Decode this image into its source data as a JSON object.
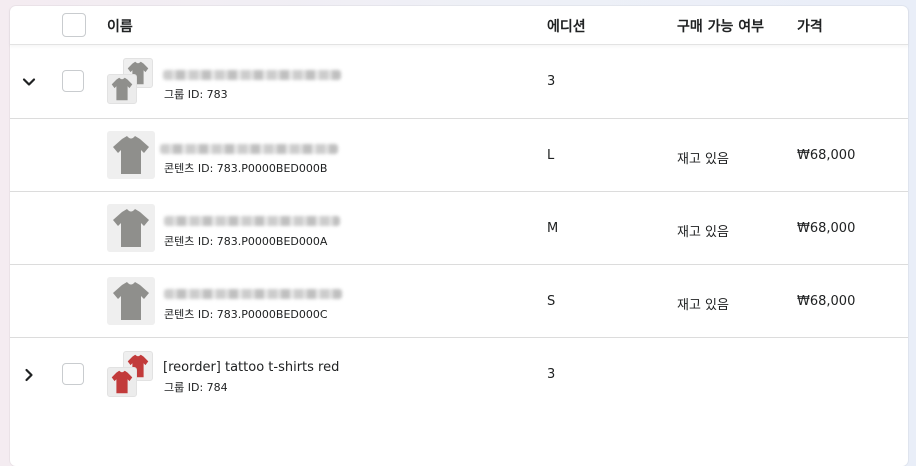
{
  "header": {
    "name_label": "이름",
    "edition_label": "에디션",
    "availability_label": "구매 가능 여부",
    "price_label": "가격"
  },
  "rows": [
    {
      "kind": "group",
      "expanded": true,
      "name": "",
      "sub": "그룹 ID: 783",
      "edition": "3",
      "availability": "",
      "price": "",
      "color": "gray"
    },
    {
      "kind": "variant",
      "name": "",
      "sub": "콘텐츠 ID: 783.P0000BED000B",
      "edition": "L",
      "availability": "재고 있음",
      "price": "₩68,000",
      "color": "gray"
    },
    {
      "kind": "variant",
      "name": "",
      "sub": "콘텐츠 ID: 783.P0000BED000A",
      "edition": "M",
      "availability": "재고 있음",
      "price": "₩68,000",
      "color": "gray"
    },
    {
      "kind": "variant",
      "name": "",
      "sub": "콘텐츠 ID: 783.P0000BED000C",
      "edition": "S",
      "availability": "재고 있음",
      "price": "₩68,000",
      "color": "gray"
    },
    {
      "kind": "group",
      "expanded": false,
      "name": "[reorder] tattoo t-shirts red",
      "sub": "그룹 ID: 784",
      "edition": "3",
      "availability": "",
      "price": "",
      "color": "red"
    }
  ],
  "colors": {
    "shirt_gray": "#8f8f8c",
    "shirt_red": "#c23b3b"
  },
  "icons": {
    "expanded": "chevron-down-icon",
    "collapsed": "chevron-right-icon",
    "thumbnail": "tshirt-icon"
  }
}
